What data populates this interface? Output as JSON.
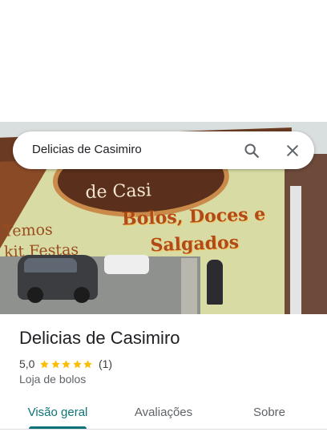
{
  "search": {
    "query": "Delicias de Casimiro",
    "search_icon": "search-icon",
    "close_icon": "close-icon"
  },
  "photo": {
    "sign_name_fragment": "de Casi",
    "sign_line1": "Temos",
    "sign_line2": "kit Festas",
    "sign_products_line1": "Bolos, Doces e",
    "sign_products_line2": "Salgados"
  },
  "place": {
    "title": "Delicias de Casimiro",
    "rating": "5,0",
    "stars": 5,
    "review_count": "(1)",
    "category": "Loja de bolos"
  },
  "tabs": [
    {
      "label": "Visão geral",
      "active": true
    },
    {
      "label": "Avaliações",
      "active": false
    },
    {
      "label": "Sobre",
      "active": false
    }
  ],
  "colors": {
    "accent": "#0d7377",
    "star": "#fbbc04",
    "text_primary": "#202124",
    "text_secondary": "#5f6368"
  }
}
